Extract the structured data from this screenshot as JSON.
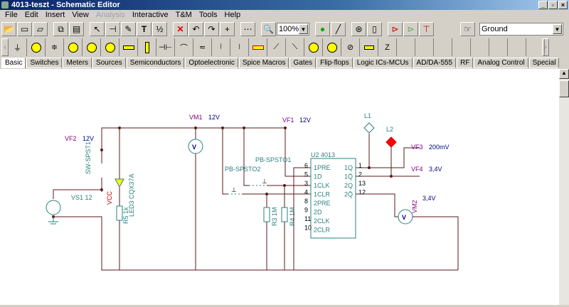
{
  "window": {
    "title": "4013-teszt - Schematic Editor",
    "controls": [
      "_",
      "▫",
      "×"
    ]
  },
  "menu": [
    "File",
    "Edit",
    "Insert",
    "View",
    "Analysis",
    "Interactive",
    "T&M",
    "Tools",
    "Help"
  ],
  "menu_disabled": [
    "Analysis"
  ],
  "toolbar": {
    "zoom": "100%",
    "ground_select": "Ground"
  },
  "tabs": [
    "Basic",
    "Switches",
    "Meters",
    "Sources",
    "Semiconductors",
    "Optoelectronic",
    "Spice Macros",
    "Gates",
    "Flip-flops",
    "Logic ICs-MCUs",
    "AD/DA-555",
    "RF",
    "Analog Control",
    "Special"
  ],
  "active_tab": "Basic",
  "schematic": {
    "vf2": "VF2",
    "vf2_val": "12V",
    "vm1": "VM1",
    "vm1_val": "12V",
    "vf1": "VF1",
    "vf1_val": "12V",
    "sw": "SW-SPST1",
    "vs1": "VS1 12",
    "vcc": "VCC",
    "led": "LED3 CQX37A",
    "r5": "R5 1k",
    "pb2": "PB-SPSTO2",
    "pb1": "PB-SPSTO1",
    "r3": "R3 1M",
    "r4": "R4 1M",
    "u2": "U2 4013",
    "pins_left": [
      [
        "6",
        "1PRE"
      ],
      [
        "5",
        "1D"
      ],
      [
        "3",
        "1CLK"
      ],
      [
        "4",
        "1CLR"
      ],
      [
        "8",
        "2PRE"
      ],
      [
        "9",
        "2D"
      ],
      [
        "11",
        "2CLK"
      ],
      [
        "10",
        "2CLR"
      ]
    ],
    "pins_right": [
      [
        "1",
        "1Q"
      ],
      [
        "2",
        "1Q̄"
      ],
      [
        "13",
        "2Q"
      ],
      [
        "12",
        "2Q̄"
      ]
    ],
    "l1": "L1",
    "l2": "L2",
    "vf3": "VF3",
    "vf3_val": "200mV",
    "vf4": "VF4",
    "vf4_val": "3,4V",
    "vm2": "VM2",
    "vm2_val": "3,4V",
    "meter_letter": "V"
  },
  "colors": {
    "wire": "#5a1a1a",
    "label": "#800080",
    "value": "#000080",
    "part": "#2a8080",
    "vcc": "#c00000",
    "l2": "#ff0000"
  }
}
